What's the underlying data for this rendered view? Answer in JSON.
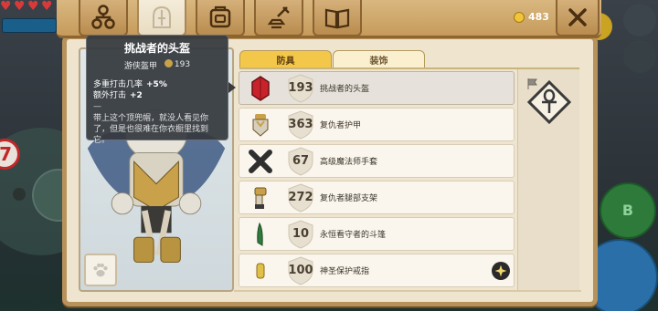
{
  "game": {
    "hearts": [
      "heart",
      "heart",
      "heart",
      "heart"
    ],
    "left_badge_text": "7",
    "b_button_label": "B"
  },
  "topbar": {
    "tabs": [
      {
        "name": "skills",
        "icon": "skill-tree-icon"
      },
      {
        "name": "equipment",
        "icon": "helmet-icon"
      },
      {
        "name": "inventory",
        "icon": "backpack-icon"
      },
      {
        "name": "crafting",
        "icon": "anvil-hammer-icon"
      },
      {
        "name": "map",
        "icon": "map-book-icon"
      }
    ],
    "coins": "483",
    "close_icon": "close-icon"
  },
  "tooltip": {
    "title": "挑战者的头盔",
    "type": "游侠盔甲",
    "level": "193",
    "stats": [
      {
        "label": "多重打击几率",
        "value": "+5%"
      },
      {
        "label": "额外打击",
        "value": "+2"
      }
    ],
    "dash": "—",
    "description": "带上这个顶兜帽，就没人看见你了，但是也很难在你衣橱里找到它。"
  },
  "subtabs": {
    "armor": "防具",
    "decoration": "装饰"
  },
  "items": [
    {
      "level": "193",
      "name": "挑战者的头盔",
      "icon": "red-helmet-icon",
      "selected": true
    },
    {
      "level": "363",
      "name": "复仇者护甲",
      "icon": "gold-armor-icon",
      "selected": false
    },
    {
      "level": "67",
      "name": "高级魔法师手套",
      "icon": "crossed-gloves-icon",
      "selected": false
    },
    {
      "level": "272",
      "name": "复仇者腿部支架",
      "icon": "leg-armor-icon",
      "selected": false
    },
    {
      "level": "10",
      "name": "永恒看守者的斗篷",
      "icon": "green-cloak-icon",
      "selected": false
    },
    {
      "level": "100",
      "name": "神圣保护戒指",
      "icon": "gold-ring-icon",
      "selected": false
    }
  ],
  "right_slot": {
    "icon": "ankh-icon",
    "flag_icon": "flag-icon"
  },
  "colors": {
    "panel_bg": "#efe4ce",
    "topbar": "#c69b5c",
    "active_subtab": "#f3c84a",
    "tooltip_bg": "#363a40",
    "coin": "#f1c43a"
  }
}
